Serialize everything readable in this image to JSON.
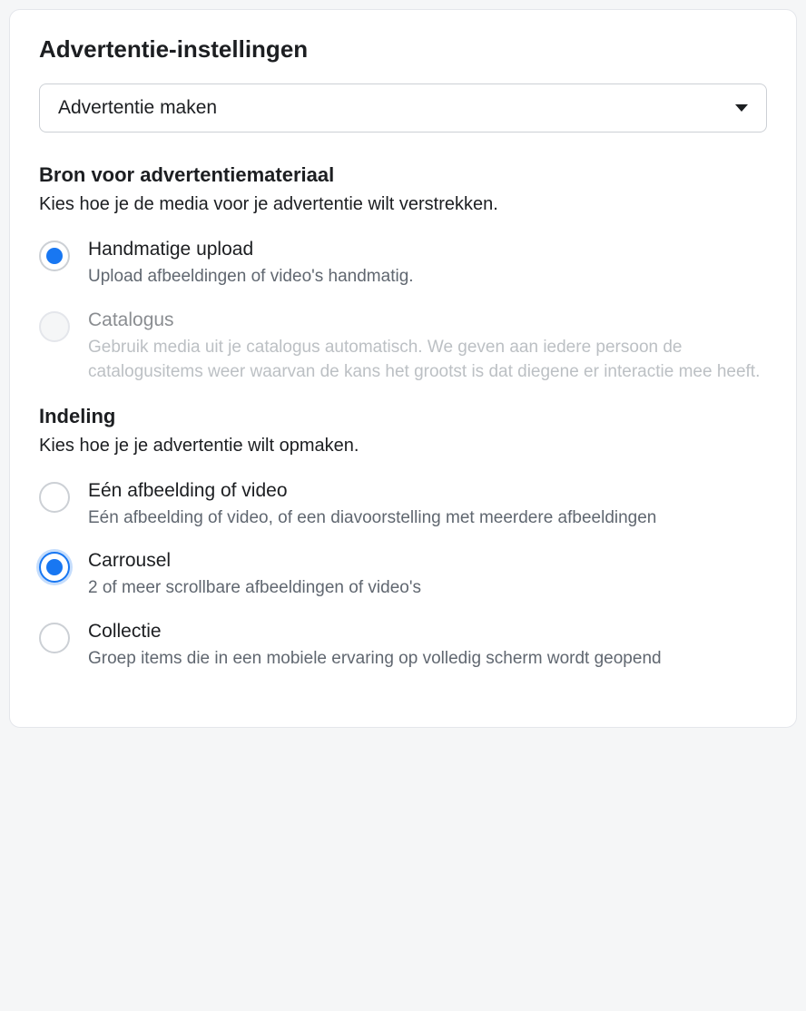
{
  "title": "Advertentie-instellingen",
  "dropdown": {
    "label": "Advertentie maken"
  },
  "source": {
    "heading": "Bron voor advertentiemateriaal",
    "desc": "Kies hoe je de media voor je advertentie wilt verstrekken.",
    "options": [
      {
        "title": "Handmatige upload",
        "desc": "Upload afbeeldingen of video's handmatig.",
        "selected": true,
        "disabled": false
      },
      {
        "title": "Catalogus",
        "desc": "Gebruik media uit je catalogus automatisch. We geven aan iedere persoon de catalogusitems weer waarvan de kans het grootst is dat diegene er interactie mee heeft.",
        "selected": false,
        "disabled": true
      }
    ]
  },
  "format": {
    "heading": "Indeling",
    "desc": "Kies hoe je je advertentie wilt opmaken.",
    "options": [
      {
        "title": "Eén afbeelding of video",
        "desc": "Eén afbeelding of video, of een diavoorstelling met meerdere afbeeldingen",
        "selected": false,
        "disabled": false
      },
      {
        "title": "Carrousel",
        "desc": "2 of meer scrollbare afbeeldingen of video's",
        "selected": true,
        "disabled": false
      },
      {
        "title": "Collectie",
        "desc": "Groep items die in een mobiele ervaring op volledig scherm wordt geopend",
        "selected": false,
        "disabled": false
      }
    ]
  }
}
